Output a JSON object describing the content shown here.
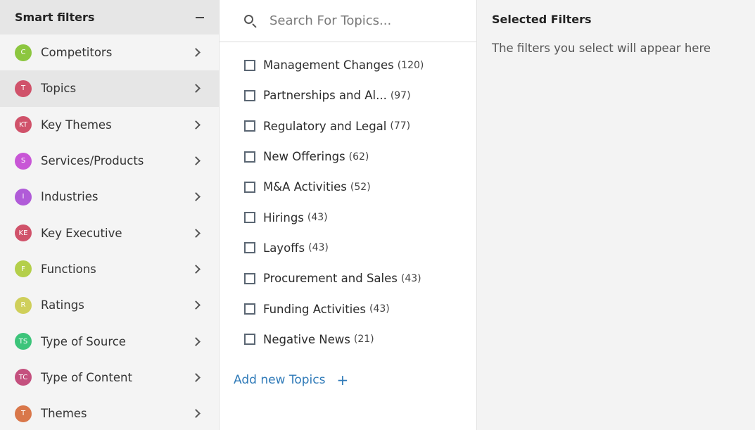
{
  "sidebar": {
    "title": "Smart filters",
    "collapse_icon": "minus-icon",
    "items": [
      {
        "abbr": "C",
        "label": "Competitors",
        "color": "#8cc63f",
        "active": false
      },
      {
        "abbr": "T",
        "label": "Topics",
        "color": "#d0526a",
        "active": true
      },
      {
        "abbr": "KT",
        "label": "Key Themes",
        "color": "#d0526a",
        "active": false
      },
      {
        "abbr": "S",
        "label": "Services/Products",
        "color": "#c856d6",
        "active": false
      },
      {
        "abbr": "I",
        "label": "Industries",
        "color": "#b05bd8",
        "active": false
      },
      {
        "abbr": "KE",
        "label": "Key Executive",
        "color": "#d0526a",
        "active": false
      },
      {
        "abbr": "F",
        "label": "Functions",
        "color": "#b4cf4a",
        "active": false
      },
      {
        "abbr": "R",
        "label": "Ratings",
        "color": "#cfcf5a",
        "active": false
      },
      {
        "abbr": "TS",
        "label": "Type of Source",
        "color": "#3cc47a",
        "active": false
      },
      {
        "abbr": "TC",
        "label": "Type of Content",
        "color": "#c4507e",
        "active": false
      },
      {
        "abbr": "T",
        "label": "Themes",
        "color": "#d9774a",
        "active": false
      }
    ]
  },
  "search": {
    "placeholder": "Search For Topics...",
    "value": ""
  },
  "topics": [
    {
      "name": "Management Changes",
      "count": "(120)",
      "checked": false
    },
    {
      "name": "Partnerships and Al...",
      "count": "(97)",
      "checked": false
    },
    {
      "name": "Regulatory and Legal",
      "count": "(77)",
      "checked": false
    },
    {
      "name": "New Offerings",
      "count": "(62)",
      "checked": false
    },
    {
      "name": "M&A Activities",
      "count": "(52)",
      "checked": false
    },
    {
      "name": "Hirings",
      "count": "(43)",
      "checked": false
    },
    {
      "name": "Layoffs",
      "count": "(43)",
      "checked": false
    },
    {
      "name": "Procurement and Sales",
      "count": "(43)",
      "checked": false
    },
    {
      "name": "Funding Activities",
      "count": "(43)",
      "checked": false
    },
    {
      "name": "Negative News",
      "count": "(21)",
      "checked": false
    }
  ],
  "add_topic": {
    "label": "Add new Topics",
    "plus": "+"
  },
  "selected_panel": {
    "title": "Selected Filters",
    "empty_text": "The filters you select will appear here"
  }
}
